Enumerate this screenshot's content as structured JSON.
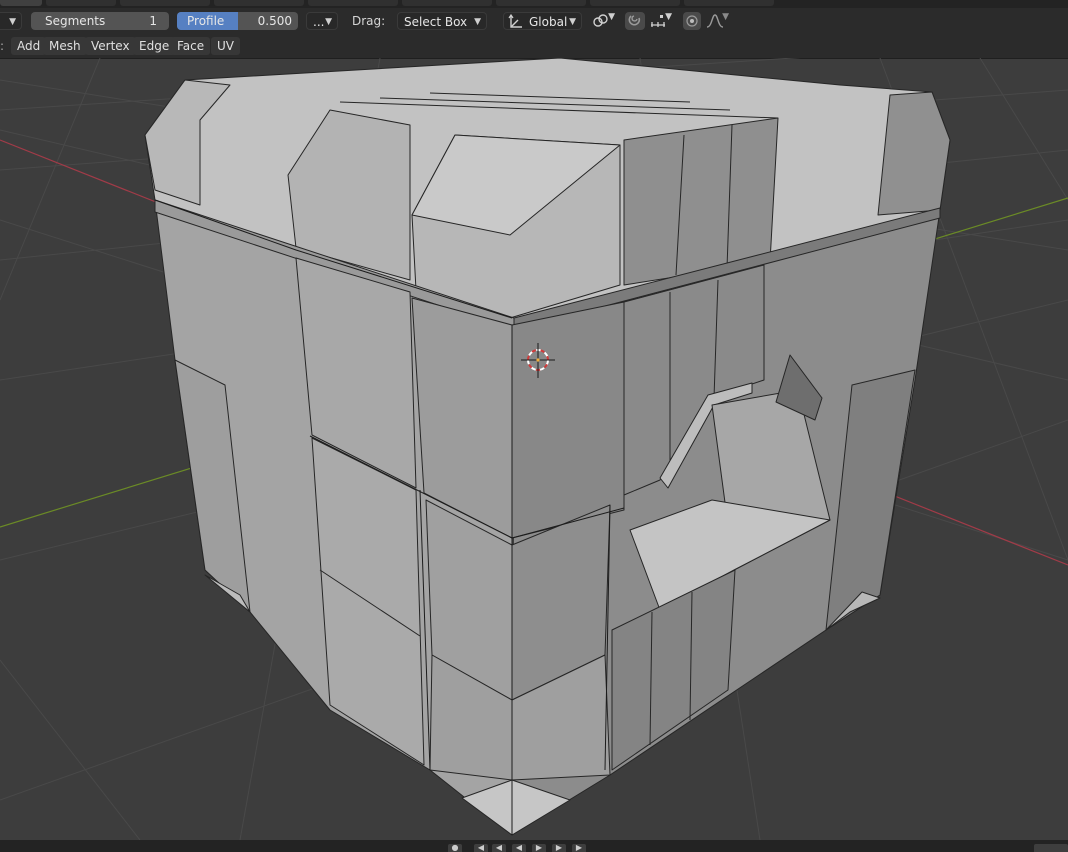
{
  "toolbar": {
    "segments_label": "Segments",
    "segments_value": "1",
    "profile_label": "Profile",
    "profile_value": "0.500",
    "profile_fill_fraction": 0.5,
    "more_label": "...",
    "drag_label": "Drag:",
    "drag_mode": "Select Box",
    "orientation": "Global"
  },
  "menubar": {
    "items": [
      "Add",
      "Mesh",
      "Vertex",
      "Edge",
      "Face",
      "UV"
    ]
  },
  "colors": {
    "accent": "#5680c2",
    "viewport_bg": "#3d3d3d",
    "grid": "#494949",
    "axis_x": "#a13b48",
    "axis_y": "#6b8b26",
    "mesh_light": "#b4b4b4",
    "mesh_mid": "#8f8f8f",
    "mesh_dark": "#6e6e6e"
  },
  "icons": {
    "orientation": "transform-orientation-icon",
    "pivot": "snap-link-icon",
    "snap": "magnet-icon",
    "snap_target": "snap-increment-icon",
    "proportional": "proportional-edit-icon",
    "falloff": "falloff-curve-icon",
    "cursor": "3d-cursor-icon"
  }
}
